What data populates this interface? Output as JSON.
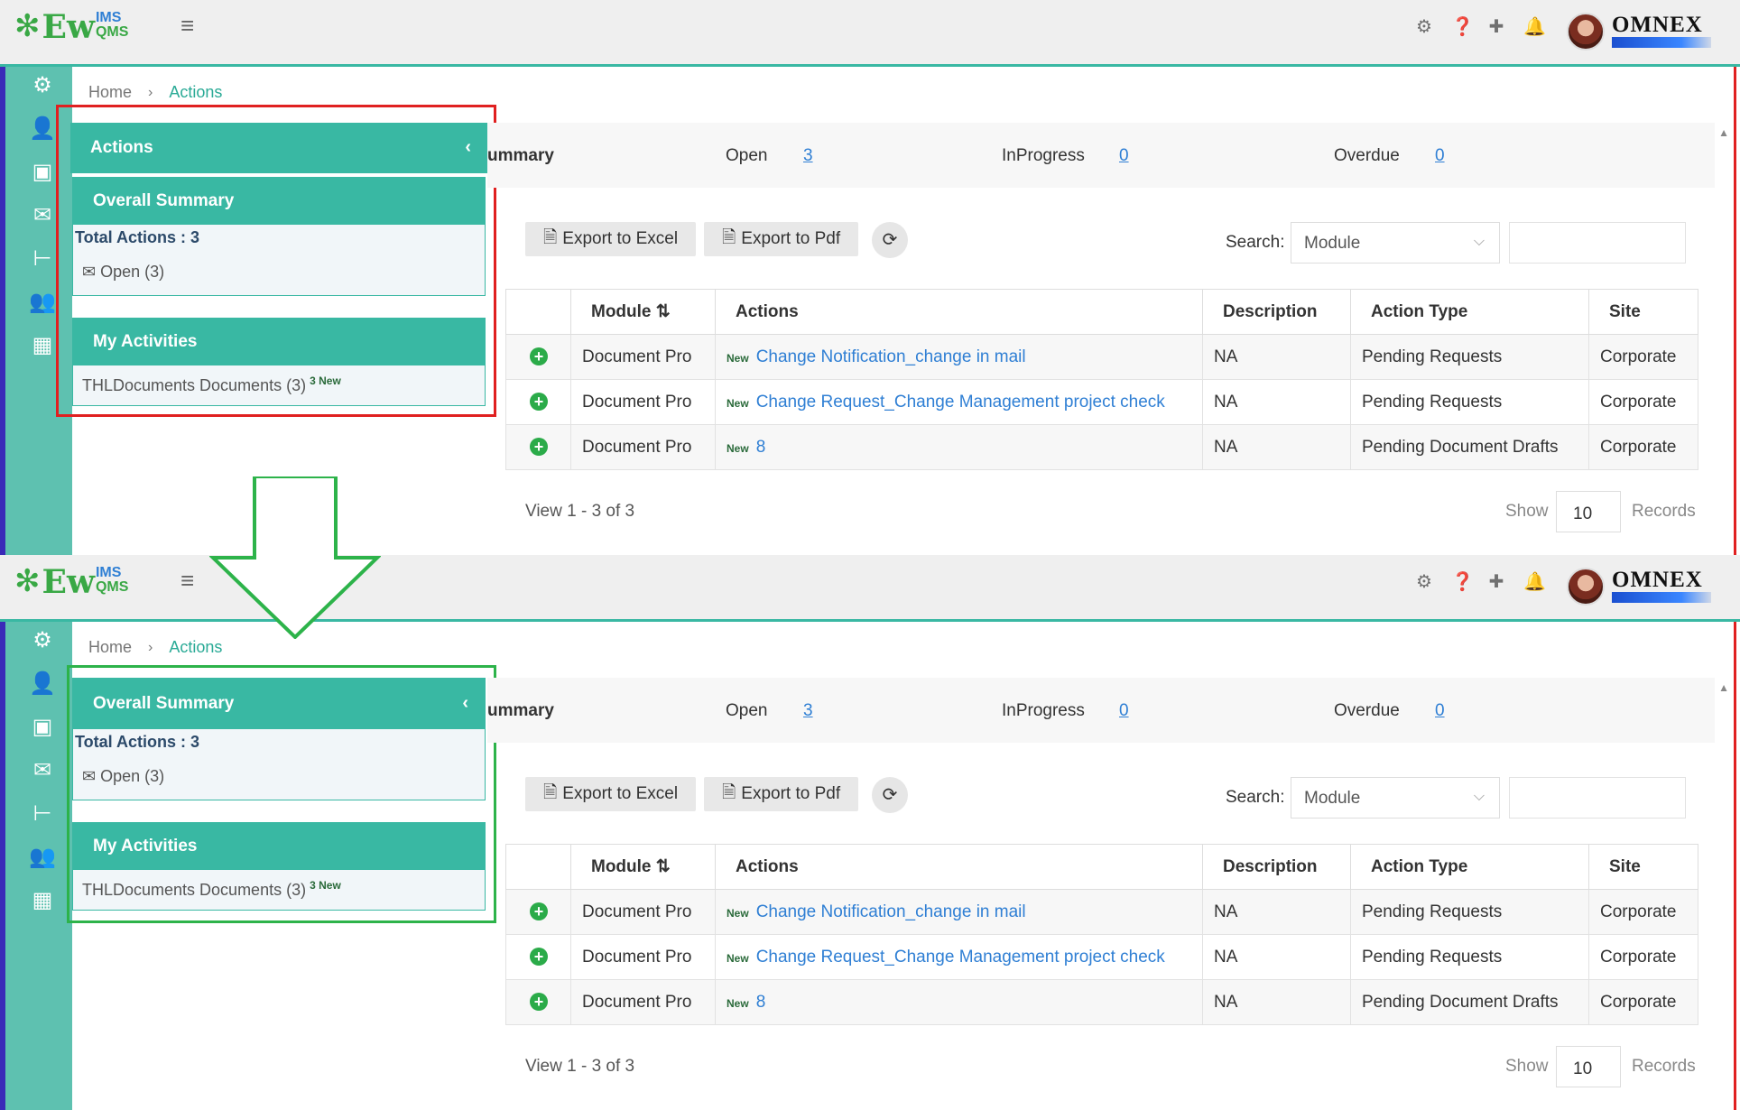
{
  "header": {
    "logo_ew": "Ew",
    "logo_ims": "IMS",
    "logo_qms": "QMS",
    "brand": "OMNEX"
  },
  "breadcrumb": {
    "home": "Home",
    "current": "Actions"
  },
  "side_top": {
    "actions_header": "Actions",
    "overall_summary": "Overall Summary",
    "total_actions": "Total Actions : 3",
    "open": "Open (3)",
    "my_activities": "My Activities",
    "activity_item": "THLDocuments Documents (3)",
    "activity_badge": "3 New"
  },
  "side_bottom": {
    "overall_summary": "Overall Summary",
    "total_actions": "Total Actions : 3",
    "open": "Open (3)",
    "my_activities": "My Activities",
    "activity_item": "THLDocuments Documents (3)",
    "activity_badge": "3 New"
  },
  "summary": {
    "title": "ummary",
    "open_label": "Open",
    "open_value": "3",
    "inprogress_label": "InProgress",
    "inprogress_value": "0",
    "overdue_label": "Overdue",
    "overdue_value": "0"
  },
  "toolbar": {
    "export_excel": "Export to Excel",
    "export_pdf": "Export to Pdf",
    "search_label": "Search:",
    "search_select": "Module"
  },
  "table": {
    "columns": [
      "Module",
      "Actions",
      "Description",
      "Action Type",
      "Site"
    ],
    "new_tag": "New",
    "rows": [
      {
        "module": "Document Pro",
        "action": "Change Notification_change in mail",
        "description": "NA",
        "type": "Pending Requests",
        "site": "Corporate"
      },
      {
        "module": "Document Pro",
        "action": "Change Request_Change Management project check",
        "description": "NA",
        "type": "Pending Requests",
        "site": "Corporate"
      },
      {
        "module": "Document Pro",
        "action": "8",
        "description": "NA",
        "type": "Pending Document Drafts",
        "site": "Corporate"
      }
    ]
  },
  "pager": {
    "view": "View 1 - 3 of 3",
    "show": "Show",
    "records_value": "10",
    "records": "Records"
  },
  "colors": {
    "teal": "#39b8a3",
    "red_frame": "#e02020",
    "green_frame": "#2db34a",
    "link": "#2f7fd4"
  }
}
